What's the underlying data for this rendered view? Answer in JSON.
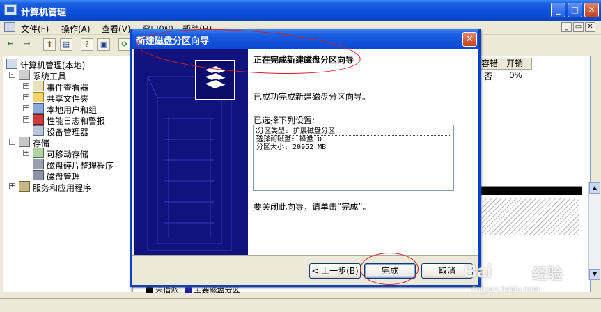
{
  "window": {
    "title": "计算机管理",
    "controls": {
      "minimize": "_",
      "maximize": "□",
      "close": "✕"
    }
  },
  "menu": [
    "文件(F)",
    "操作(A)",
    "查看(V)",
    "窗口(W)",
    "帮助(H)"
  ],
  "mdi_controls": [
    "_",
    "▭",
    "✕"
  ],
  "toolbar": [
    "back-icon",
    "forward-icon",
    "up-icon",
    "show-hide-tree-icon",
    "properties-icon",
    "export-icon",
    "refresh-icon"
  ],
  "tree": {
    "root": "计算机管理(本地)",
    "items": [
      {
        "label": "系统工具",
        "expander": "-",
        "icon": "tools-icon"
      },
      {
        "label": "事件查看器",
        "expander": "+",
        "icon": "event-viewer-icon"
      },
      {
        "label": "共享文件夹",
        "expander": "+",
        "icon": "shared-folder-icon"
      },
      {
        "label": "本地用户和组",
        "expander": "+",
        "icon": "users-icon"
      },
      {
        "label": "性能日志和警报",
        "expander": "+",
        "icon": "performance-icon"
      },
      {
        "label": "设备管理器",
        "expander": "",
        "icon": "device-manager-icon"
      },
      {
        "label": "存储",
        "expander": "-",
        "icon": "storage-icon"
      },
      {
        "label": "可移动存储",
        "expander": "+",
        "icon": "removable-storage-icon"
      },
      {
        "label": "磁盘碎片整理程序",
        "expander": "",
        "icon": "defrag-icon"
      },
      {
        "label": "磁盘管理",
        "expander": "",
        "icon": "disk-management-icon"
      },
      {
        "label": "服务和应用程序",
        "expander": "+",
        "icon": "services-icon"
      }
    ]
  },
  "volume_list": {
    "columns": [
      "容错",
      "开销"
    ],
    "row": [
      "否",
      "0%"
    ]
  },
  "legend": [
    {
      "label": "未指派",
      "color": "#000000"
    },
    {
      "label": "主要磁盘分区",
      "color": "#1c1ca8"
    }
  ],
  "dialog": {
    "title": "新建磁盘分区向导",
    "close": "✕",
    "heading": "正在完成新建磁盘分区向导",
    "success_text": "已成功完成新建磁盘分区向导。",
    "selected_label": "已选择下列设置:",
    "summary_lines": [
      "分区类型: 扩展磁盘分区",
      "选择的磁盘: 磁盘 0",
      "分区大小: 20952 MB"
    ],
    "close_hint": "要关闭此向导，请单击“完成”。",
    "buttons": {
      "back": "< 上一步(B)",
      "finish": "完成",
      "cancel": "取消"
    }
  },
  "watermark": {
    "brand_latin": "Bai",
    "brand_cn": "经验",
    "site": "jingyan.baidu.com"
  }
}
